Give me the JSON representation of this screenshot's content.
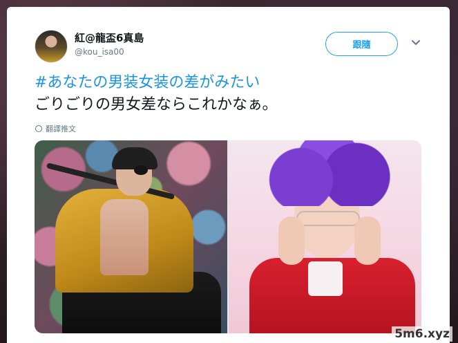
{
  "tweet": {
    "display_name": "紅@龍盃6真島",
    "handle": "@kou_isa00",
    "follow_label": "跟隨",
    "hashtag": "#あなたの男装女装の差がみたい",
    "body_line": "ごりごりの男女差ならこれかなぁ。",
    "translate_label": "翻譯推文"
  },
  "icons": {
    "caret": "chevron-down-icon",
    "globe": "globe-icon"
  },
  "colors": {
    "accent": "#1da1f2",
    "hashtag": "#1b95e0",
    "secondary_text": "#657786"
  },
  "watermark": "5m6.xyz"
}
